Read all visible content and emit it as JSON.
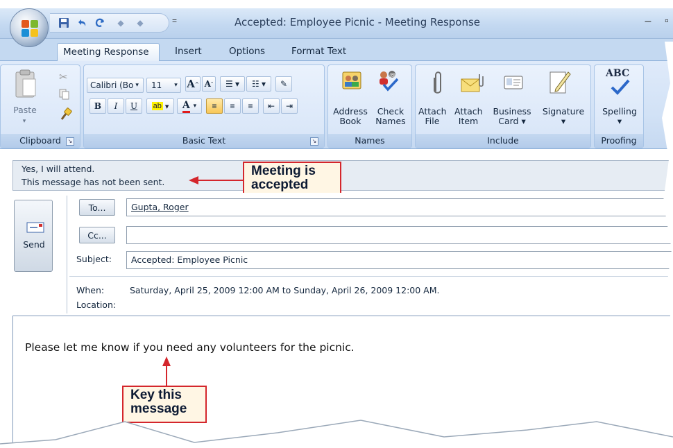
{
  "window": {
    "title": "Accepted: Employee Picnic - Meeting Response",
    "minimize_glyph": "–",
    "maximize_glyph": "▫"
  },
  "quick_access": {
    "icons": [
      "save-icon",
      "undo-icon",
      "redo-icon",
      "up-arrow-icon",
      "down-arrow-icon"
    ],
    "separator": "="
  },
  "tabs": [
    {
      "label": "Meeting Response",
      "active": true
    },
    {
      "label": "Insert"
    },
    {
      "label": "Options"
    },
    {
      "label": "Format Text"
    }
  ],
  "ribbon": {
    "clipboard": {
      "label": "Clipboard",
      "paste_label": "Paste"
    },
    "basic_text": {
      "label": "Basic Text",
      "font_name": "Calibri (Bo",
      "font_size": "11",
      "bold": "B",
      "italic": "I",
      "underline": "U"
    },
    "names": {
      "label": "Names",
      "address_book": "Address\nBook",
      "check_names": "Check\nNames"
    },
    "include": {
      "label": "Include",
      "attach_file": "Attach\nFile",
      "attach_item": "Attach\nItem",
      "business_card": "Business\nCard ▾",
      "signature": "Signature\n▾"
    },
    "proofing": {
      "label": "Proofing",
      "spelling": "Spelling\n▾",
      "abc": "ABC"
    }
  },
  "info_bar": {
    "line1": "Yes, I will attend.",
    "line2": "This message has not been sent."
  },
  "callouts": {
    "meeting_accepted": "Meeting is\naccepted",
    "key_message": "Key this\nmessage"
  },
  "header": {
    "send_label": "Send",
    "to_label": "To...",
    "to_value": "Gupta, Roger",
    "cc_label": "Cc...",
    "cc_value": "",
    "subject_label": "Subject:",
    "subject_value": "Accepted: Employee Picnic",
    "when_label": "When:",
    "when_value": "Saturday, April 25, 2009 12:00 AM to Sunday, April 26, 2009 12:00 AM.",
    "location_label": "Location:",
    "location_value": ""
  },
  "body": {
    "text": "Please let me know if you need any volunteers for the picnic."
  },
  "colors": {
    "callout_border": "#d4262c",
    "callout_fill": "#fff6e4",
    "ribbon_blue": "#c4d9f1"
  }
}
